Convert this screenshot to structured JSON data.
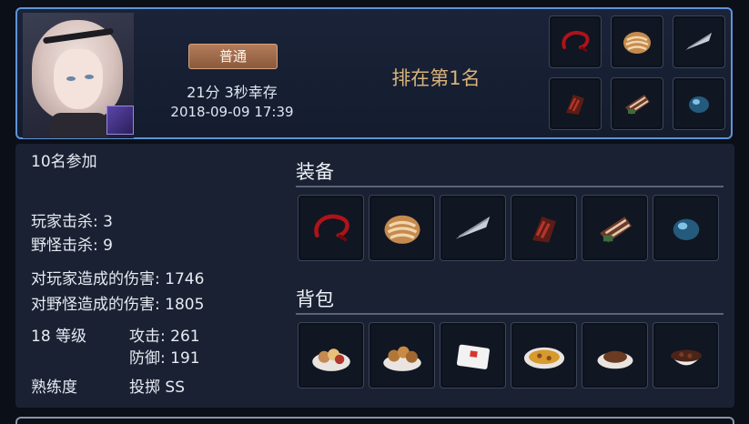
{
  "header": {
    "mode_label": "普通",
    "survival_time": "21分 3秒幸存",
    "datetime": "2018-09-09 17:39",
    "rank_text": "排在第1名"
  },
  "top_equipment": [
    {
      "icon": "red-whip-icon"
    },
    {
      "icon": "round-bread-icon"
    },
    {
      "icon": "silver-feather-blade-icon"
    },
    {
      "icon": "red-gauntlet-icon"
    },
    {
      "icon": "striped-armor-icon"
    },
    {
      "icon": "blue-gem-icon"
    }
  ],
  "stats": {
    "participants": "10名参加",
    "player_kills": "玩家击杀: 3",
    "monster_kills": "野怪击杀: 9",
    "damage_to_players": "对玩家造成的伤害: 1746",
    "damage_to_monsters": "对野怪造成的伤害: 1805",
    "level": "18 等级",
    "attack": "攻击: 261",
    "defense": "防御: 191",
    "proficiency_label": "熟练度",
    "proficiency_value": "投掷 SS"
  },
  "equipment_section": {
    "title": "装备",
    "items": [
      {
        "icon": "red-whip-icon"
      },
      {
        "icon": "round-bread-icon"
      },
      {
        "icon": "silver-feather-blade-icon"
      },
      {
        "icon": "red-gauntlet-icon"
      },
      {
        "icon": "striped-armor-icon"
      },
      {
        "icon": "blue-gem-icon"
      }
    ]
  },
  "backpack_section": {
    "title": "背包",
    "items": [
      {
        "icon": "food-plate-icon"
      },
      {
        "icon": "fried-snack-bowl-icon"
      },
      {
        "icon": "ration-box-icon"
      },
      {
        "icon": "curry-plate-icon"
      },
      {
        "icon": "steak-plate-icon"
      },
      {
        "icon": "bean-bowl-icon"
      }
    ]
  },
  "colors": {
    "accent_border": "#5f93d8",
    "rank_gold": "#d8b27a",
    "badge_brown": "#8a5a3c"
  }
}
